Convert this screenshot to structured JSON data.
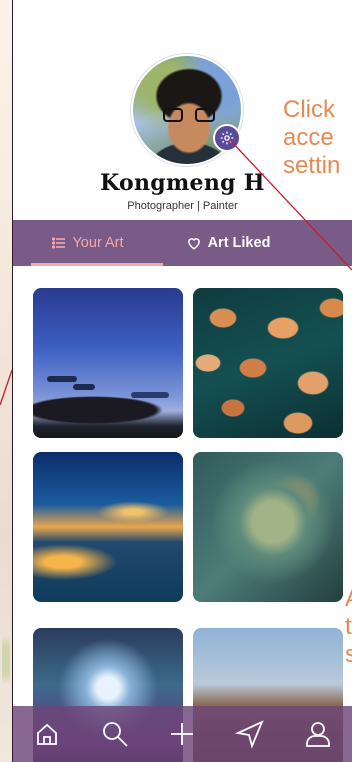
{
  "profile": {
    "name": "Kongmeng H",
    "role": "Photographer | Painter"
  },
  "tabs": [
    {
      "label": "Your Art",
      "icon": "list-icon",
      "active": true
    },
    {
      "label": "Art Liked",
      "icon": "heart-icon",
      "active": false
    }
  ],
  "gallery": {
    "items": [
      {
        "name": "dusk-sky-artwork"
      },
      {
        "name": "autumn-leaves-artwork"
      },
      {
        "name": "harbor-night-artwork"
      },
      {
        "name": "glass-orb-artwork"
      },
      {
        "name": "moonlit-forest-artwork"
      },
      {
        "name": "village-street-artwork"
      }
    ]
  },
  "annotations": {
    "callout_top": [
      "Click",
      "acce",
      "settin"
    ],
    "callout_bottom": [
      "A",
      "t",
      "s"
    ]
  },
  "nav": {
    "items": [
      "home-icon",
      "search-icon",
      "plus-icon",
      "send-icon",
      "user-icon"
    ]
  },
  "colors": {
    "tab_bar": "#7a5a86",
    "tab_active": "#f6a6ad",
    "annotation": "#e58a52",
    "settings_badge": "#5a4a9a"
  }
}
